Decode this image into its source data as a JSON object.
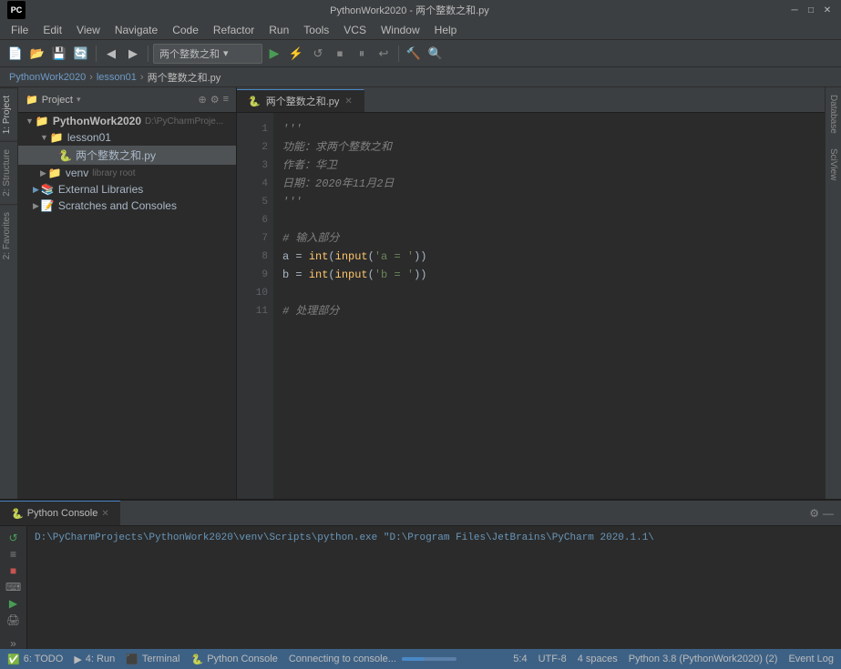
{
  "titlebar": {
    "title": "PythonWork2020 - 两个整数之和.py",
    "minimize": "─",
    "maximize": "□",
    "close": "✕"
  },
  "menubar": {
    "items": [
      "File",
      "Edit",
      "View",
      "Navigate",
      "Code",
      "Refactor",
      "Run",
      "Tools",
      "VCS",
      "Window",
      "Help"
    ]
  },
  "toolbar": {
    "dropdown_label": "两个整数之和",
    "dropdown_arrow": "▾"
  },
  "breadcrumb": {
    "project": "PythonWork2020",
    "folder": "lesson01",
    "file": "两个整数之和.py"
  },
  "project_panel": {
    "title": "Project",
    "root": "PythonWork2020",
    "root_path": "D:\\PyCharmProje...",
    "items": [
      {
        "label": "lesson01",
        "type": "folder",
        "indent": 1,
        "expanded": true
      },
      {
        "label": "两个整数之和.py",
        "type": "file",
        "indent": 2,
        "selected": true
      },
      {
        "label": "venv",
        "type": "folder",
        "indent": 1,
        "expanded": false,
        "suffix": "library root"
      },
      {
        "label": "External Libraries",
        "type": "lib",
        "indent": 0
      },
      {
        "label": "Scratches and Consoles",
        "type": "scratches",
        "indent": 0
      }
    ]
  },
  "editor": {
    "tab_name": "两个整数之和.py",
    "lines": [
      {
        "num": 1,
        "text": "'''",
        "type": "comment"
      },
      {
        "num": 2,
        "text": "功能：求两个整数之和",
        "type": "comment"
      },
      {
        "num": 3,
        "text": "作者：华卫",
        "type": "comment"
      },
      {
        "num": 4,
        "text": "日期：2020年11月2日",
        "type": "comment"
      },
      {
        "num": 5,
        "text": "'''",
        "type": "comment"
      },
      {
        "num": 6,
        "text": "",
        "type": "normal"
      },
      {
        "num": 7,
        "text": "# 输入部分",
        "type": "comment"
      },
      {
        "num": 8,
        "text": "a = int(input('a = '))",
        "type": "code"
      },
      {
        "num": 9,
        "text": "b = int(input('b = '))",
        "type": "code"
      },
      {
        "num": 10,
        "text": "",
        "type": "normal"
      },
      {
        "num": 11,
        "text": "# 处理部分",
        "type": "comment"
      }
    ]
  },
  "bottom_panel": {
    "tabs": [
      "Python Console",
      "Terminal"
    ],
    "active_tab": "Python Console",
    "console_line": "D:\\PyCharmProjects\\PythonWork2020\\venv\\Scripts\\python.exe \"D:\\Program Files\\JetBrains\\PyCharm 2020.1.1\\"
  },
  "right_tabs": [
    "Database",
    "SciView"
  ],
  "left_side_tabs": [
    "1: Project",
    "2: Structure",
    "2: Favorites"
  ],
  "status_bar": {
    "todo": "6: TODO",
    "run": "4: Run",
    "terminal": "Terminal",
    "python_console": "Python Console",
    "event_log": "Event Log",
    "position": "5:4",
    "encoding": "UTF-8",
    "indent": "4 spaces",
    "python_version": "Python 3.8 (PythonWork2020) (2)",
    "connecting": "Connecting to console..."
  }
}
